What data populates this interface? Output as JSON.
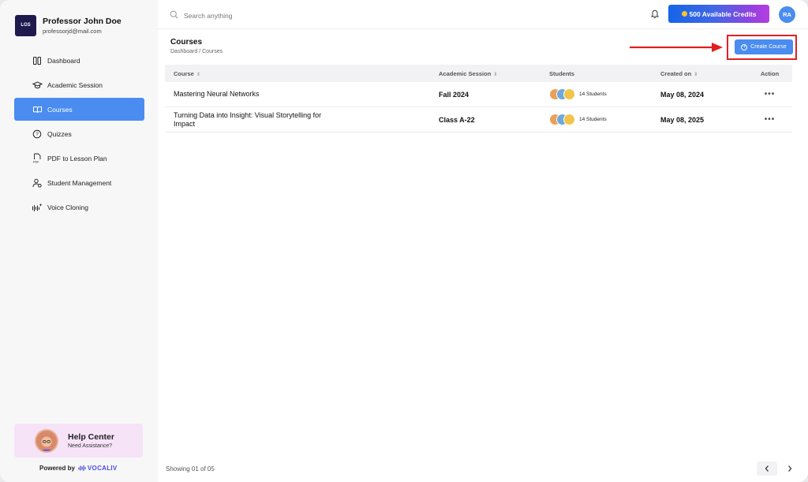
{
  "profile": {
    "logo_text": "LGS",
    "name": "Professor John Doe",
    "email": "professorjd@mail.com"
  },
  "nav": {
    "items": [
      {
        "label": "Dashboard",
        "icon": "dashboard-icon"
      },
      {
        "label": "Academic Session",
        "icon": "graduation-cap-icon"
      },
      {
        "label": "Courses",
        "icon": "book-open-icon",
        "active": true
      },
      {
        "label": "Quizzes",
        "icon": "quiz-icon"
      },
      {
        "label": "PDF to Lesson Plan",
        "icon": "pdf-icon"
      },
      {
        "label": "Student Management",
        "icon": "user-gear-icon"
      },
      {
        "label": "Voice Cloning",
        "icon": "voice-wave-icon"
      }
    ]
  },
  "help": {
    "title": "Help Center",
    "subtitle": "Need Assistance?"
  },
  "powered": {
    "label": "Powered by",
    "brand": "VOCALIV"
  },
  "topbar": {
    "search_placeholder": "Search anything",
    "credits_label": "500 Available Credits",
    "avatar_initials": "RA"
  },
  "page": {
    "title": "Courses",
    "breadcrumb": "Dashboard / Courses",
    "create_label": "Create Course"
  },
  "table": {
    "headers": [
      "Course",
      "Academic Session",
      "Students",
      "Created on",
      "Action"
    ],
    "rows": [
      {
        "course": "Mastering Neural Networks",
        "session": "Fall 2024",
        "students": "14 Students",
        "created": "May 08, 2024",
        "action": "•••"
      },
      {
        "course": "Turning Data into Insight: Visual Storytelling for Impact",
        "session": "Class A-22",
        "students": "14 Students",
        "created": "May 08, 2025",
        "action": "•••"
      }
    ]
  },
  "footer": {
    "showing": "Showing 01 of 05"
  },
  "colors": {
    "accent": "#4a8cf0",
    "highlight": "#e02020",
    "credits_start": "#1565e8",
    "credits_end": "#b43fe0"
  }
}
